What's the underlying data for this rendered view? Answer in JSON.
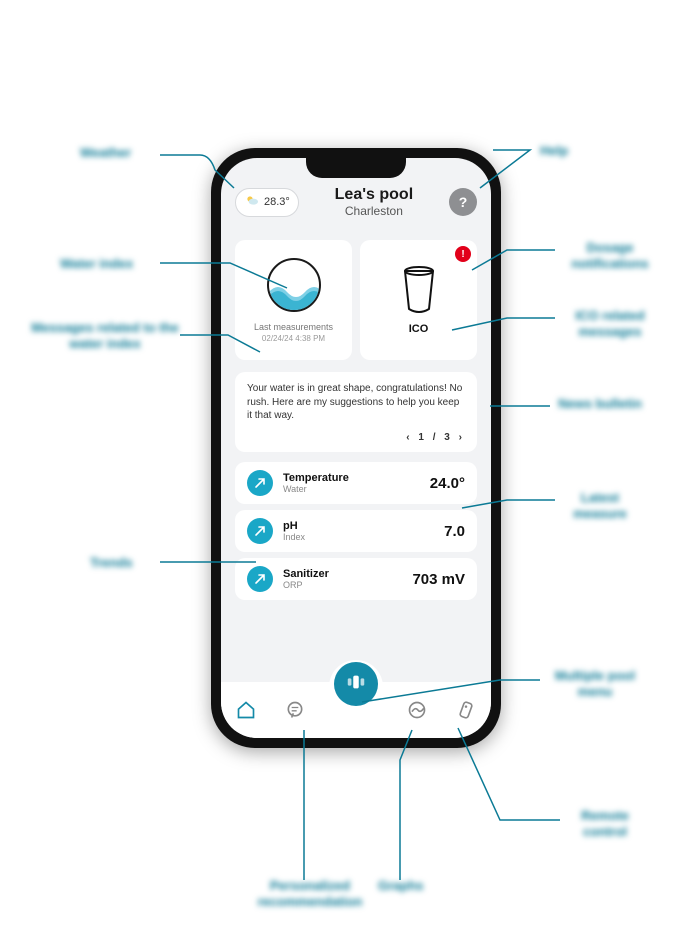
{
  "header": {
    "weather_temp": "28.3°",
    "title": "Lea's pool",
    "subtitle": "Charleston",
    "help_glyph": "?"
  },
  "water_card": {
    "last_label": "Last measurements",
    "last_time": "02/24/24 4:38 PM"
  },
  "ico_card": {
    "label": "ICO",
    "badge": "!"
  },
  "message": {
    "text": "Your water is in great shape, congratulations! No rush. Here are my suggestions to help you keep it that way.",
    "pager_prev": "‹",
    "pager_text": "1 / 3",
    "pager_next": "›"
  },
  "metrics": [
    {
      "title": "Temperature",
      "sub": "Water",
      "value": "24.0°"
    },
    {
      "title": "pH",
      "sub": "Index",
      "value": "7.0"
    },
    {
      "title": "Sanitizer",
      "sub": "ORP",
      "value": "703 mV"
    }
  ],
  "callouts": {
    "weather": "Weather",
    "help": "Help",
    "water_index": "Water index",
    "messages_related": "Messages related to the water index",
    "dosage_notif": "Dosage notifications",
    "ico_related": "ICO related messages",
    "news_bulletin": "News bulletin",
    "latest_measure": "Latest measure",
    "trends": "Trends",
    "multi_pool": "Multiple pool menu",
    "remote_control": "Remote control",
    "personalized": "Personalized recommendation",
    "graphs": "Graphs"
  }
}
